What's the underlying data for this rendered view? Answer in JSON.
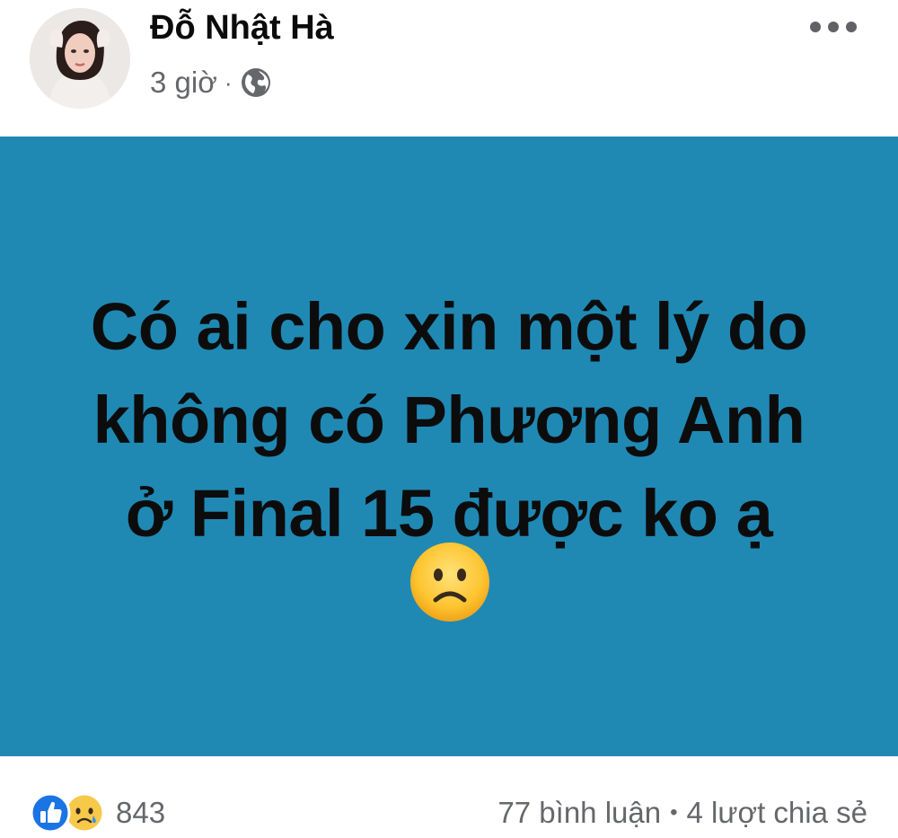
{
  "post": {
    "author": "Đỗ Nhật Hà",
    "time": "3 giờ",
    "meta_separator": "·",
    "audience_icon": "globe-icon",
    "more_icon": "more-horizontal-icon",
    "text_lines": [
      "Có ai cho xin một lý do",
      "không có Phương Anh",
      "ở Final 15 được ko ạ"
    ],
    "emoji": "sad-face-emoji",
    "background_color": "#1f89b4"
  },
  "footer": {
    "reaction_icons": [
      "like-reaction-icon",
      "sad-reaction-icon"
    ],
    "reaction_count": "843",
    "comments": "77 bình luận",
    "separator": "•",
    "shares": "4 lượt chia sẻ"
  }
}
